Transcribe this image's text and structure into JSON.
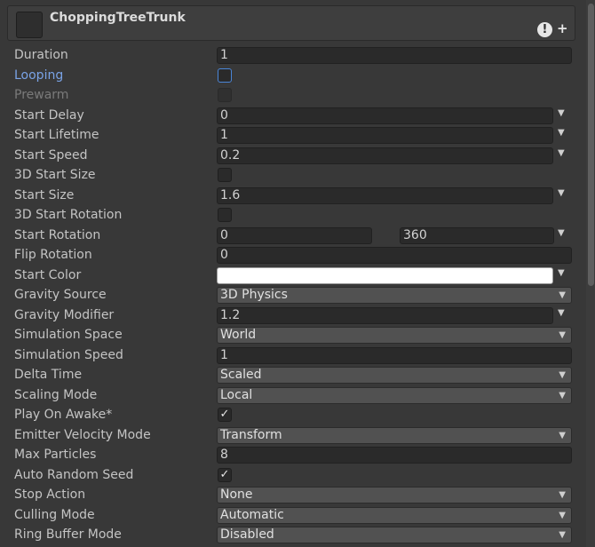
{
  "header": {
    "title": "ChoppingTreeTrunk",
    "warning_icon": "warning-icon",
    "add_icon": "plus-icon"
  },
  "rows": {
    "duration": {
      "label": "Duration",
      "value": "1"
    },
    "looping": {
      "label": "Looping",
      "checked": false
    },
    "prewarm": {
      "label": "Prewarm",
      "checked": false
    },
    "start_delay": {
      "label": "Start Delay",
      "value": "0"
    },
    "start_lifetime": {
      "label": "Start Lifetime",
      "value": "1"
    },
    "start_speed": {
      "label": "Start Speed",
      "value": "0.2"
    },
    "start_size_3d": {
      "label": "3D Start Size",
      "checked": false
    },
    "start_size": {
      "label": "Start Size",
      "value": "1.6"
    },
    "start_rotation_3d": {
      "label": "3D Start Rotation",
      "checked": false
    },
    "start_rotation": {
      "label": "Start Rotation",
      "min": "0",
      "max": "360"
    },
    "flip_rotation": {
      "label": "Flip Rotation",
      "value": "0"
    },
    "start_color": {
      "label": "Start Color",
      "color": "#ffffff"
    },
    "gravity_source": {
      "label": "Gravity Source",
      "value": "3D Physics"
    },
    "gravity_modifier": {
      "label": "Gravity Modifier",
      "value": "1.2"
    },
    "simulation_space": {
      "label": "Simulation Space",
      "value": "World"
    },
    "simulation_speed": {
      "label": "Simulation Speed",
      "value": "1"
    },
    "delta_time": {
      "label": "Delta Time",
      "value": "Scaled"
    },
    "scaling_mode": {
      "label": "Scaling Mode",
      "value": "Local"
    },
    "play_on_awake": {
      "label": "Play On Awake*",
      "checked": true
    },
    "emitter_velocity_mode": {
      "label": "Emitter Velocity Mode",
      "value": "Transform"
    },
    "max_particles": {
      "label": "Max Particles",
      "value": "8"
    },
    "auto_random_seed": {
      "label": "Auto Random Seed",
      "checked": true
    },
    "stop_action": {
      "label": "Stop Action",
      "value": "None"
    },
    "culling_mode": {
      "label": "Culling Mode",
      "value": "Automatic"
    },
    "ring_buffer_mode": {
      "label": "Ring Buffer Mode",
      "value": "Disabled"
    }
  },
  "symbols": {
    "caret": "▼",
    "check": "✓"
  },
  "colors": {
    "background": "#383838",
    "field": "#2a2a2a",
    "select": "#515151",
    "highlight_label": "#7aa3e6",
    "focus_border": "#4a86d8"
  }
}
